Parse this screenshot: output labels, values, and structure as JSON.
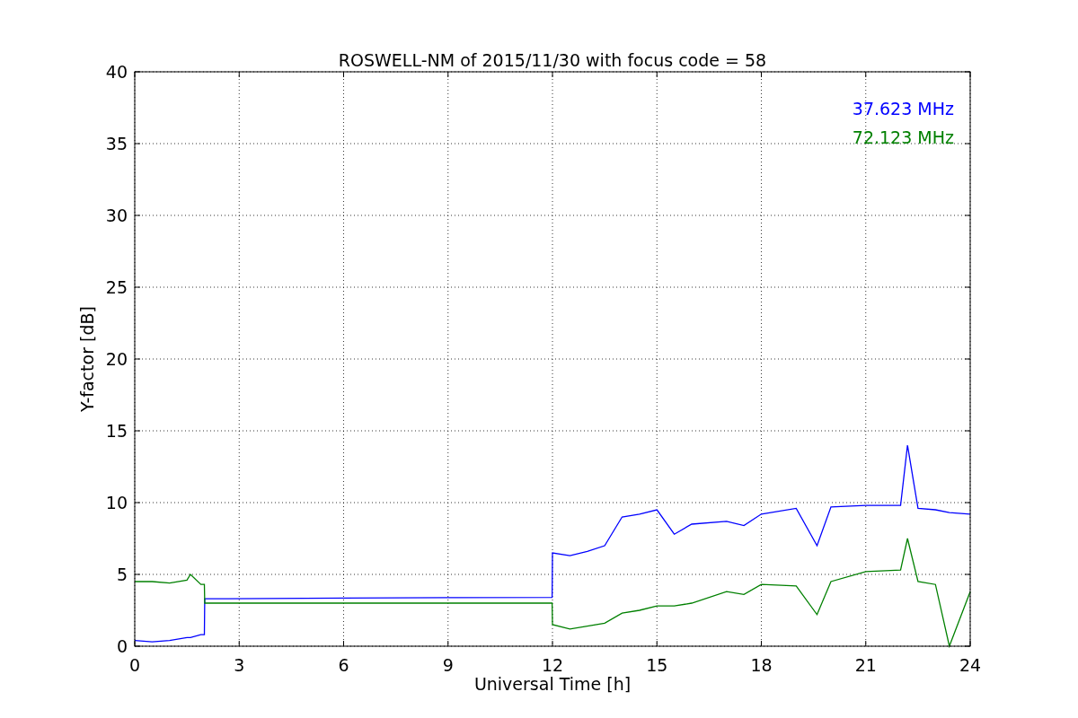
{
  "chart_data": {
    "type": "line",
    "title": "ROSWELL-NM of 2015/11/30 with focus code = 58",
    "xlabel": "Universal Time [h]",
    "ylabel": "Y-factor [dB]",
    "x": [
      0,
      0.5,
      1,
      1.5,
      1.6,
      1.9,
      2.0,
      2.01,
      6,
      9,
      11.99,
      12,
      12.5,
      13,
      13.5,
      14,
      14.5,
      15,
      15.5,
      16,
      17,
      17.5,
      18,
      19,
      19.6,
      20,
      21,
      22,
      22.2,
      22.5,
      23,
      23.4,
      24
    ],
    "series": [
      {
        "name": "37.623 MHz",
        "color": "#0000ff",
        "values": [
          0.4,
          0.3,
          0.4,
          0.6,
          0.6,
          0.8,
          0.8,
          3.3,
          3.35,
          3.38,
          3.4,
          6.5,
          6.3,
          6.6,
          7,
          9,
          9.2,
          9.5,
          7.8,
          8.5,
          8.7,
          8.4,
          9.2,
          9.6,
          7,
          9.7,
          9.8,
          9.8,
          14,
          9.6,
          9.5,
          9.3,
          9.2
        ]
      },
      {
        "name": "72.123 MHz",
        "color": "#008000",
        "values": [
          4.5,
          4.5,
          4.4,
          4.6,
          5.0,
          4.3,
          4.3,
          3.0,
          3.0,
          3.0,
          3.0,
          1.5,
          1.2,
          1.4,
          1.6,
          2.3,
          2.5,
          2.8,
          2.8,
          3.0,
          3.8,
          3.6,
          4.3,
          4.2,
          2.2,
          4.5,
          5.2,
          5.3,
          7.5,
          4.5,
          4.3,
          0,
          3.8
        ]
      }
    ],
    "xlim": [
      0,
      24
    ],
    "ylim": [
      0,
      40
    ],
    "xticks": [
      0,
      3,
      6,
      9,
      12,
      15,
      18,
      21,
      24
    ],
    "yticks": [
      0,
      5,
      10,
      15,
      20,
      25,
      30,
      35,
      40
    ],
    "grid": true
  }
}
